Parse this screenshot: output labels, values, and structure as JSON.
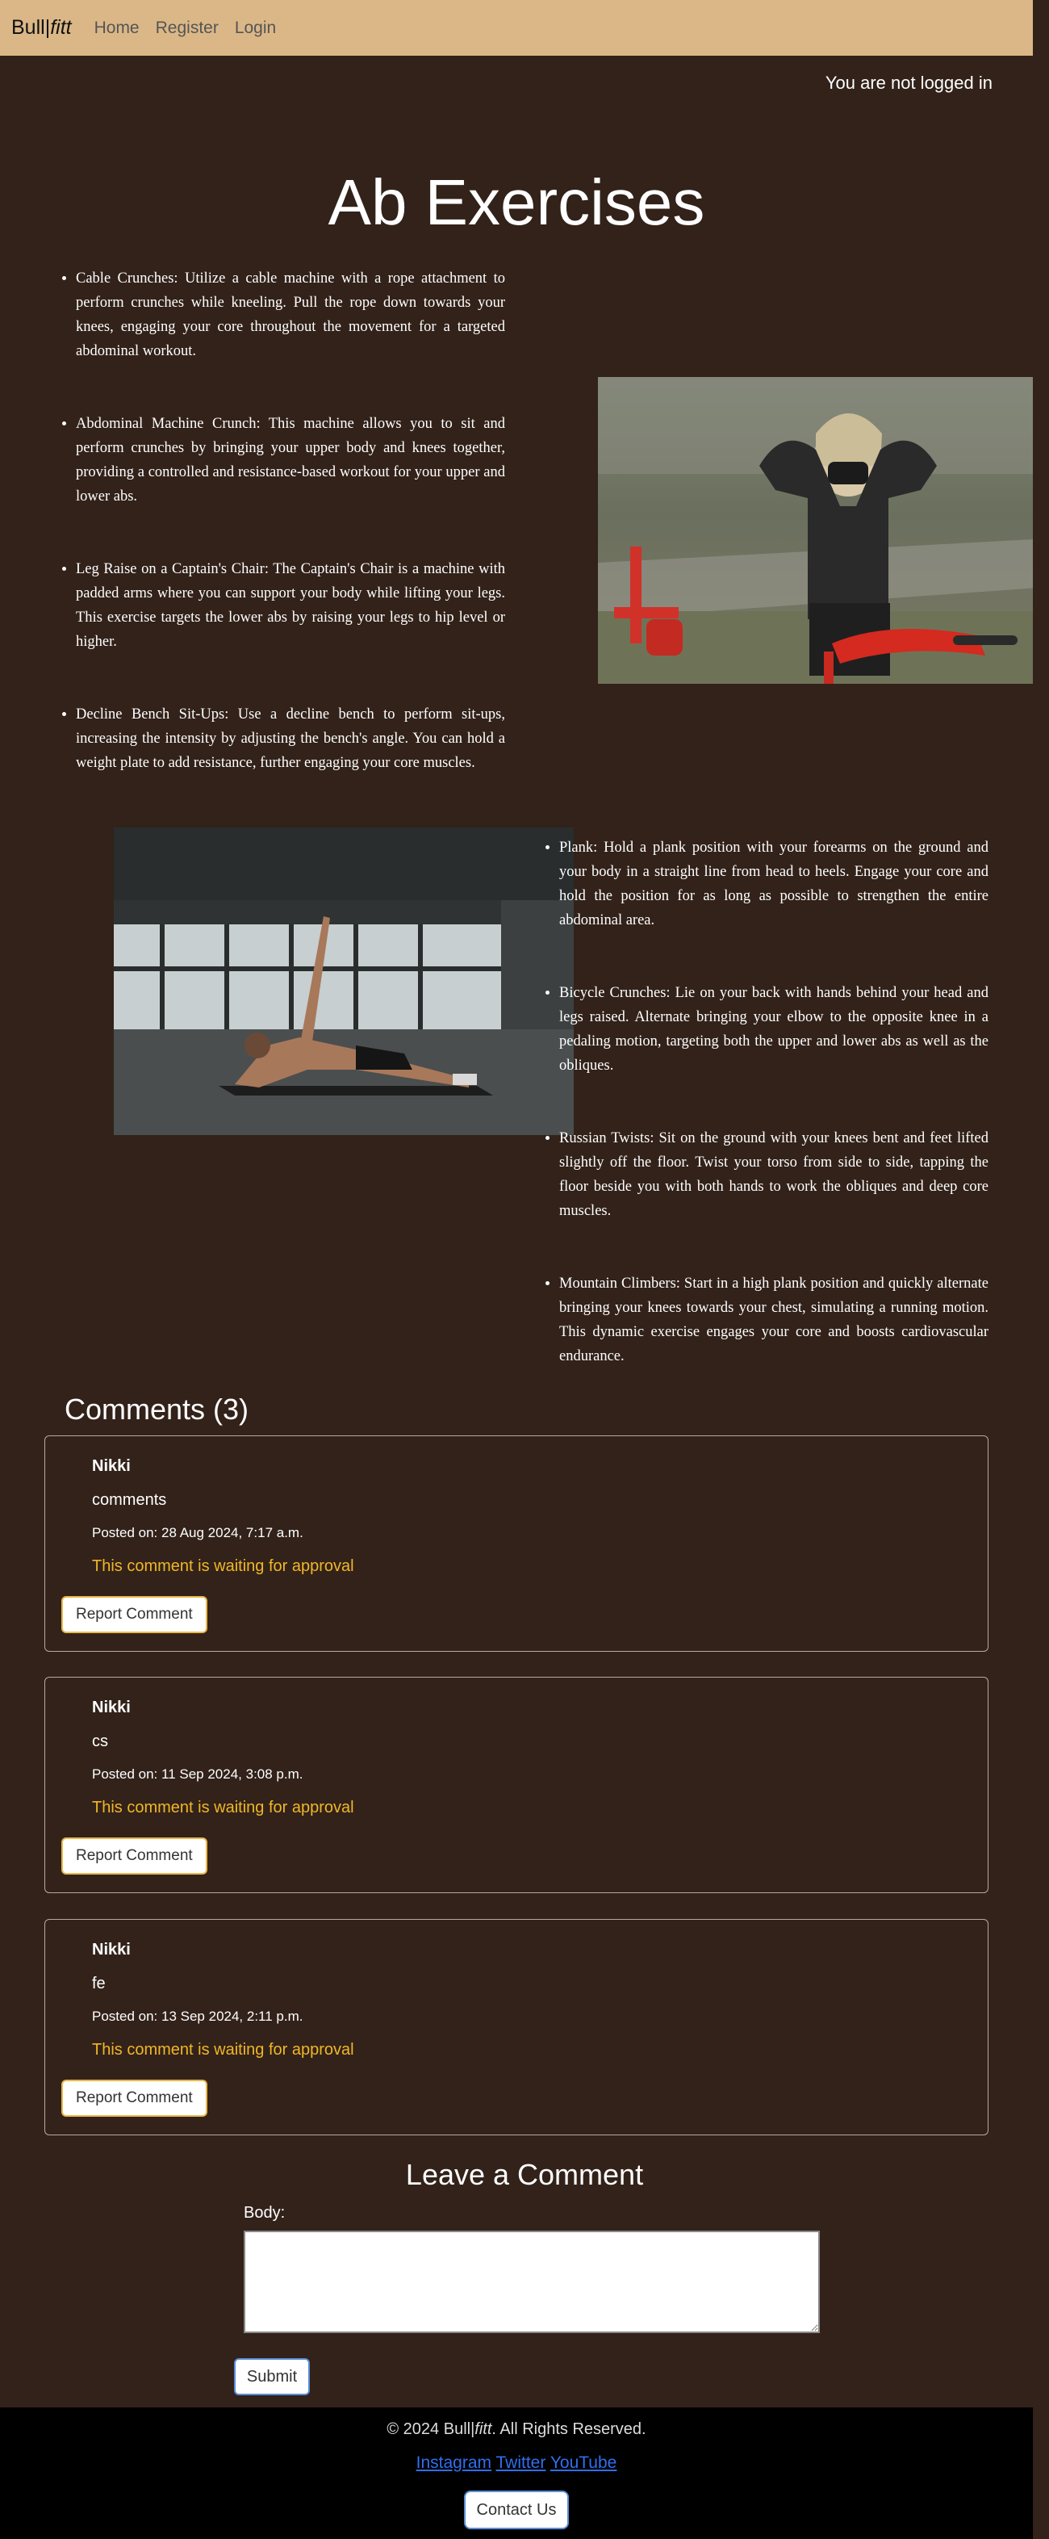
{
  "nav": {
    "brand_main": "Bull",
    "brand_sep": "|",
    "brand_fitt": "fitt",
    "links": [
      "Home",
      "Register",
      "Login"
    ]
  },
  "auth_status": "You are not logged in",
  "page_title": "Ab Exercises",
  "exercises_group_1": [
    "Cable Crunches: Utilize a cable machine with a rope attachment to perform crunches while kneeling. Pull the rope down towards your knees, engaging your core throughout the movement for a targeted abdominal workout.",
    "Abdominal Machine Crunch: This machine allows you to sit and perform crunches by bringing your upper body and knees together, providing a controlled and resistance-based workout for your upper and lower abs.",
    "Leg Raise on a Captain's Chair: The Captain's Chair is a machine with padded arms where you can support your body while lifting your legs. This exercise targets the lower abs by raising your legs to hip level or higher.",
    "Decline Bench Sit-Ups: Use a decline bench to perform sit-ups, increasing the intensity by adjusting the bench's angle. You can hold a weight plate to add resistance, further engaging your core muscles."
  ],
  "exercises_group_2": [
    "Plank: Hold a plank position with your forearms on the ground and your body in a straight line from head to heels. Engage your core and hold the position for as long as possible to strengthen the entire abdominal area.",
    "Bicycle Crunches: Lie on your back with hands behind your head and legs raised. Alternate bringing your elbow to the opposite knee in a pedaling motion, targeting both the upper and lower abs as well as the obliques.",
    "Russian Twists: Sit on the ground with your knees bent and feet lifted slightly off the floor. Twist your torso from side to side, tapping the floor beside you with both hands to work the obliques and deep core muscles.",
    "Mountain Climbers: Start in a high plank position and quickly alternate bringing your knees towards your chest, simulating a running motion. This dynamic exercise engages your core and boosts cardiovascular endurance."
  ],
  "comments_heading": "Comments (3)",
  "comments": [
    {
      "author": "Nikki",
      "body": "comments",
      "date": "Posted on: 28 Aug 2024, 7:17 a.m.",
      "status": "This comment is waiting for approval",
      "report_label": "Report Comment"
    },
    {
      "author": "Nikki",
      "body": "cs",
      "date": "Posted on: 11 Sep 2024, 3:08 p.m.",
      "status": "This comment is waiting for approval",
      "report_label": "Report Comment"
    },
    {
      "author": "Nikki",
      "body": "fe",
      "date": "Posted on: 13 Sep 2024, 2:11 p.m.",
      "status": "This comment is waiting for approval",
      "report_label": "Report Comment"
    }
  ],
  "leave_comment": {
    "heading": "Leave a Comment",
    "body_label": "Body:",
    "submit_label": "Submit"
  },
  "footer": {
    "copy_prefix": "© 2024 Bull|",
    "copy_fitt": "fitt",
    "copy_suffix": ". All Rights Reserved.",
    "social_links": [
      "Instagram",
      "Twitter",
      "YouTube"
    ],
    "contact_label": "Contact Us"
  },
  "colors": {
    "page_bg": "#32221a",
    "navbar_bg": "#dbb787",
    "status_yellow": "#f0b727",
    "link_blue": "#2f6ff0",
    "footer_bg": "#000000"
  }
}
